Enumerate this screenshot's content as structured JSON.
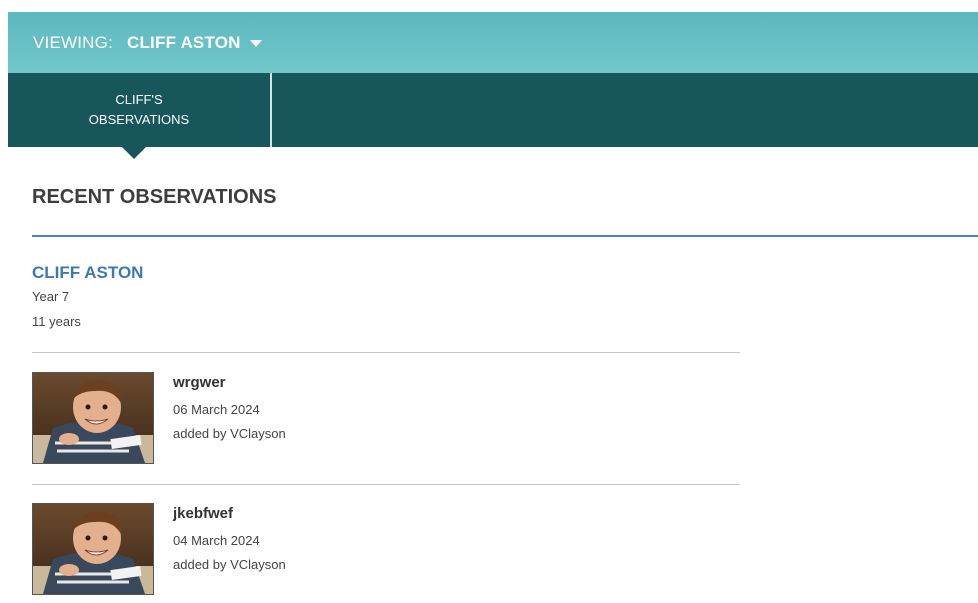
{
  "header": {
    "viewing_label": "VIEWING:",
    "viewing_name": "CLIFF ASTON"
  },
  "nav": {
    "tabs": [
      {
        "label_line1": "CLIFF'S",
        "label_line2": "OBSERVATIONS",
        "active": true
      }
    ]
  },
  "section": {
    "title": "RECENT OBSERVATIONS"
  },
  "student": {
    "name": "CLIFF ASTON",
    "year": "Year 7",
    "age": "11 years"
  },
  "observations": [
    {
      "title": "wrgwer",
      "date": "06 March 2024",
      "author": "added by VClayson"
    },
    {
      "title": "jkebfwef",
      "date": "04 March 2024",
      "author": "added by VClayson"
    }
  ],
  "colors": {
    "header_teal": "#6cc2c6",
    "nav_dark_teal": "#17575b",
    "accent_blue": "#3d79b0"
  }
}
